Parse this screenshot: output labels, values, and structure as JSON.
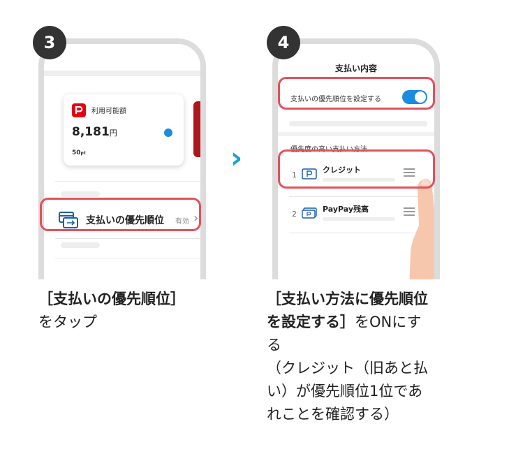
{
  "step3": {
    "number": "3",
    "card": {
      "label": "利用可能額",
      "amount": "8,181",
      "currency": "円",
      "points": "50",
      "points_unit": "pt"
    },
    "row": {
      "label": "支払いの優先順位",
      "status": "有効",
      "chevron": "›"
    },
    "caption_bold": "［支払いの優先順位］",
    "caption_rest": "をタップ"
  },
  "arrow": "›",
  "step4": {
    "number": "4",
    "header_title": "支払い内容",
    "toggle_label": "支払いの優先順位を設定する",
    "toggle_on": true,
    "section_title": "優先度の高い支払い方法",
    "methods": [
      {
        "rank": "1",
        "name": "クレジット",
        "icon": "paypay-card-icon"
      },
      {
        "rank": "2",
        "name": "PayPay残高",
        "icon": "paypay-balance-icon"
      }
    ],
    "caption_bold_line1": "［支払い方法に優先順位",
    "caption_bold_line2": "を設定する］",
    "caption_line2_rest": "をONにす",
    "caption_line3": "る",
    "caption_line4": "（クレジット（旧あと払",
    "caption_line5": "い）が優先順位1位であ",
    "caption_line6": "れことを確認する）"
  },
  "colors": {
    "accent_blue": "#1a8ce0",
    "highlight_red": "#e0525c",
    "paypay_red": "#e50012",
    "arrow_blue": "#1aa0d8"
  }
}
